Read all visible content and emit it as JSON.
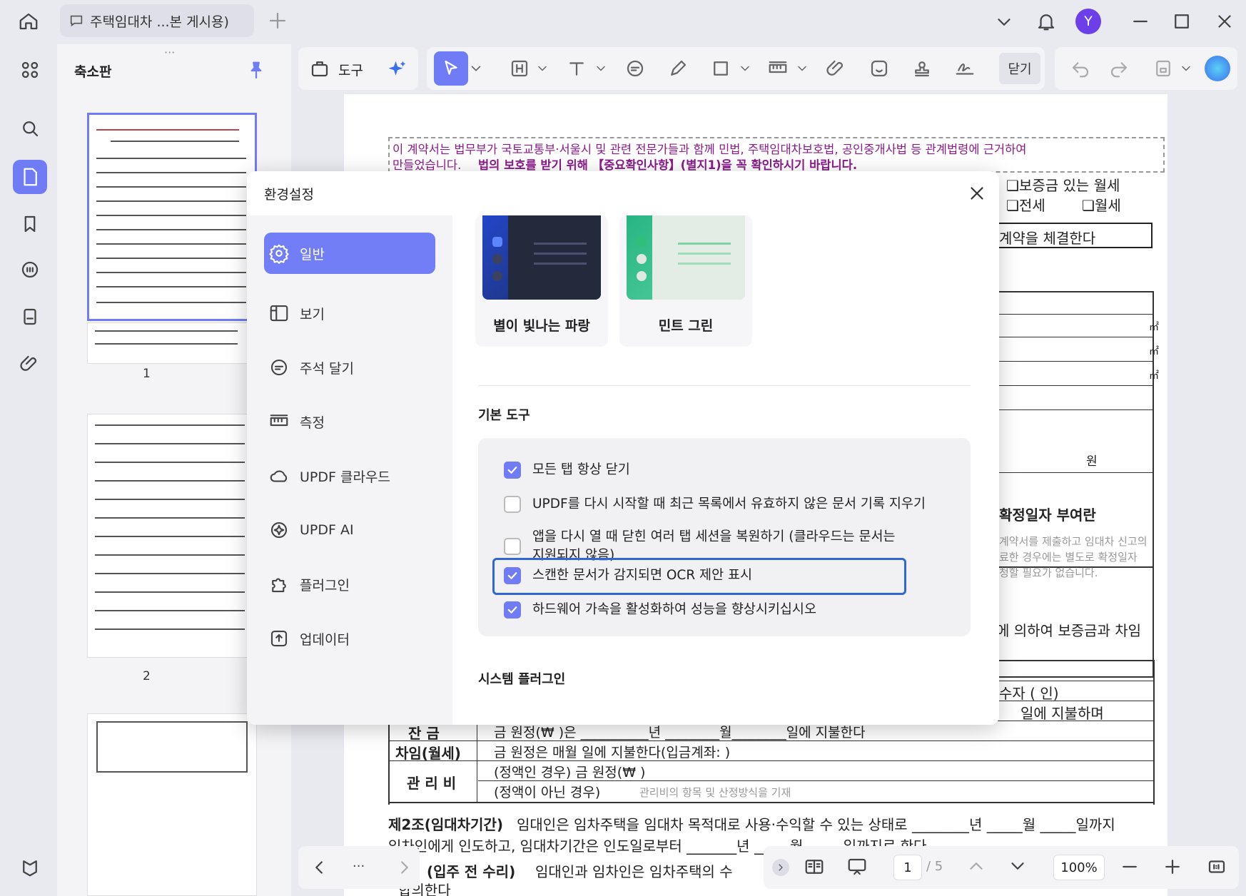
{
  "tab": {
    "title": "주택임대차 ...본 게시용)"
  },
  "titlebar": {
    "avatar": "Y"
  },
  "toolbar": {
    "tools_label": "도구",
    "close_label": "닫기"
  },
  "thumbnails": {
    "header": "축소판",
    "pages": [
      "1",
      "2"
    ]
  },
  "document": {
    "notice_line1": "이 계약서는 법무부가 국토교통부·서울시 및 관련 전문가들과 함께 민법, 주택임대차보호법, 공인중개사법 등 관계법령에 근거하여",
    "notice_line2a": "만들었습니다.",
    "notice_line2b": "법의 보호를 받기 위해 【중요확인사항】(별지1)을 꼭 확인하시기 바랍니다.",
    "r_deposit_monthly": "❏보증금 있는 월세",
    "r_jeonse": "❏전세",
    "r_monthly": "❏월세",
    "r_contract": "계약을 체결한다",
    "r_m2": "㎡",
    "r_won": "원",
    "r_fixed_date": "확정일자 부여란",
    "r_fixed_note1": "계약서를 제출하고 임대차 신고의",
    "r_fixed_note2": "료한 경우에는 별도로 확정일자",
    "r_fixed_note3": "청할 필요가 없습니다.",
    "r_pay": "에 의하여 보증금과 차임",
    "r_person": "수자 (          인)",
    "r_pay1": "일에 지불하며",
    "r_pay2": "일에 지불한다",
    "row_balance_label": "잔   금",
    "row_balance_text": "금                    원정(₩                    )은 __________년 ________월________일에 지불한다",
    "row_rent_label": "차임(월세)",
    "row_rent_text": "금                    원정은  매월        일에 지불한다(입금계좌:                                           )",
    "row_mgmt_label": "관 리 비",
    "row_mgmt_fixed": "(정액인 경우) 금                                            원정(₩                                          )",
    "row_mgmt_nonfixed": "(정액이 아닌 경우)",
    "row_mgmt_note": "관리비의 항목 및 산정방식을 기재",
    "art2_title": "제2조(임대차기간)",
    "art2_text": "임대인은 임차주택을 임대차 목적대로 사용·수익할 수 있는 상태로 ________년 _____월 _____일까지",
    "art2_text2": "임차인에게 인도하고, 임대차기간은 인도일로부터 _______년 _____월 _____일까지로 한다.",
    "art3_title": "(입주 전 수리)",
    "art3_text": "임대인과 임차인은 임차주택의 수",
    "art3_text2": "합의한다"
  },
  "bottom_bar": {
    "more": "···",
    "page_current": "1",
    "page_total": "/ 5",
    "zoom": "100%"
  },
  "dialog": {
    "title": "환경설정",
    "nav": [
      "일반",
      "보기",
      "주석 달기",
      "측정",
      "UPDF 클라우드",
      "UPDF AI",
      "플러그인",
      "업데이터"
    ],
    "themes": [
      "별이 빛나는 파랑",
      "민트 그린"
    ],
    "basic_tools_title": "기본 도구",
    "options": [
      "모든 탭 항상 닫기",
      "UPDF를 다시 시작할 때 최근 목록에서 유효하지 않은 문서 기록 지우기",
      "앱을 다시 열 때 닫힌 여러 탭 세션을 복원하기 (클라우드는 문서는",
      "지원되지 않음)",
      "스캔한 문서가 감지되면 OCR 제안 표시",
      "하드웨어 가속을 활성화하여 성능을 향상시키십시오"
    ],
    "option_states": [
      true,
      false,
      false,
      true,
      true
    ],
    "system_plugins_title": "시스템 플러그인"
  },
  "colors": {
    "accent": "#727ef5",
    "focus_ring": "#3166d8",
    "notice_purple": "#8b1a8b"
  }
}
